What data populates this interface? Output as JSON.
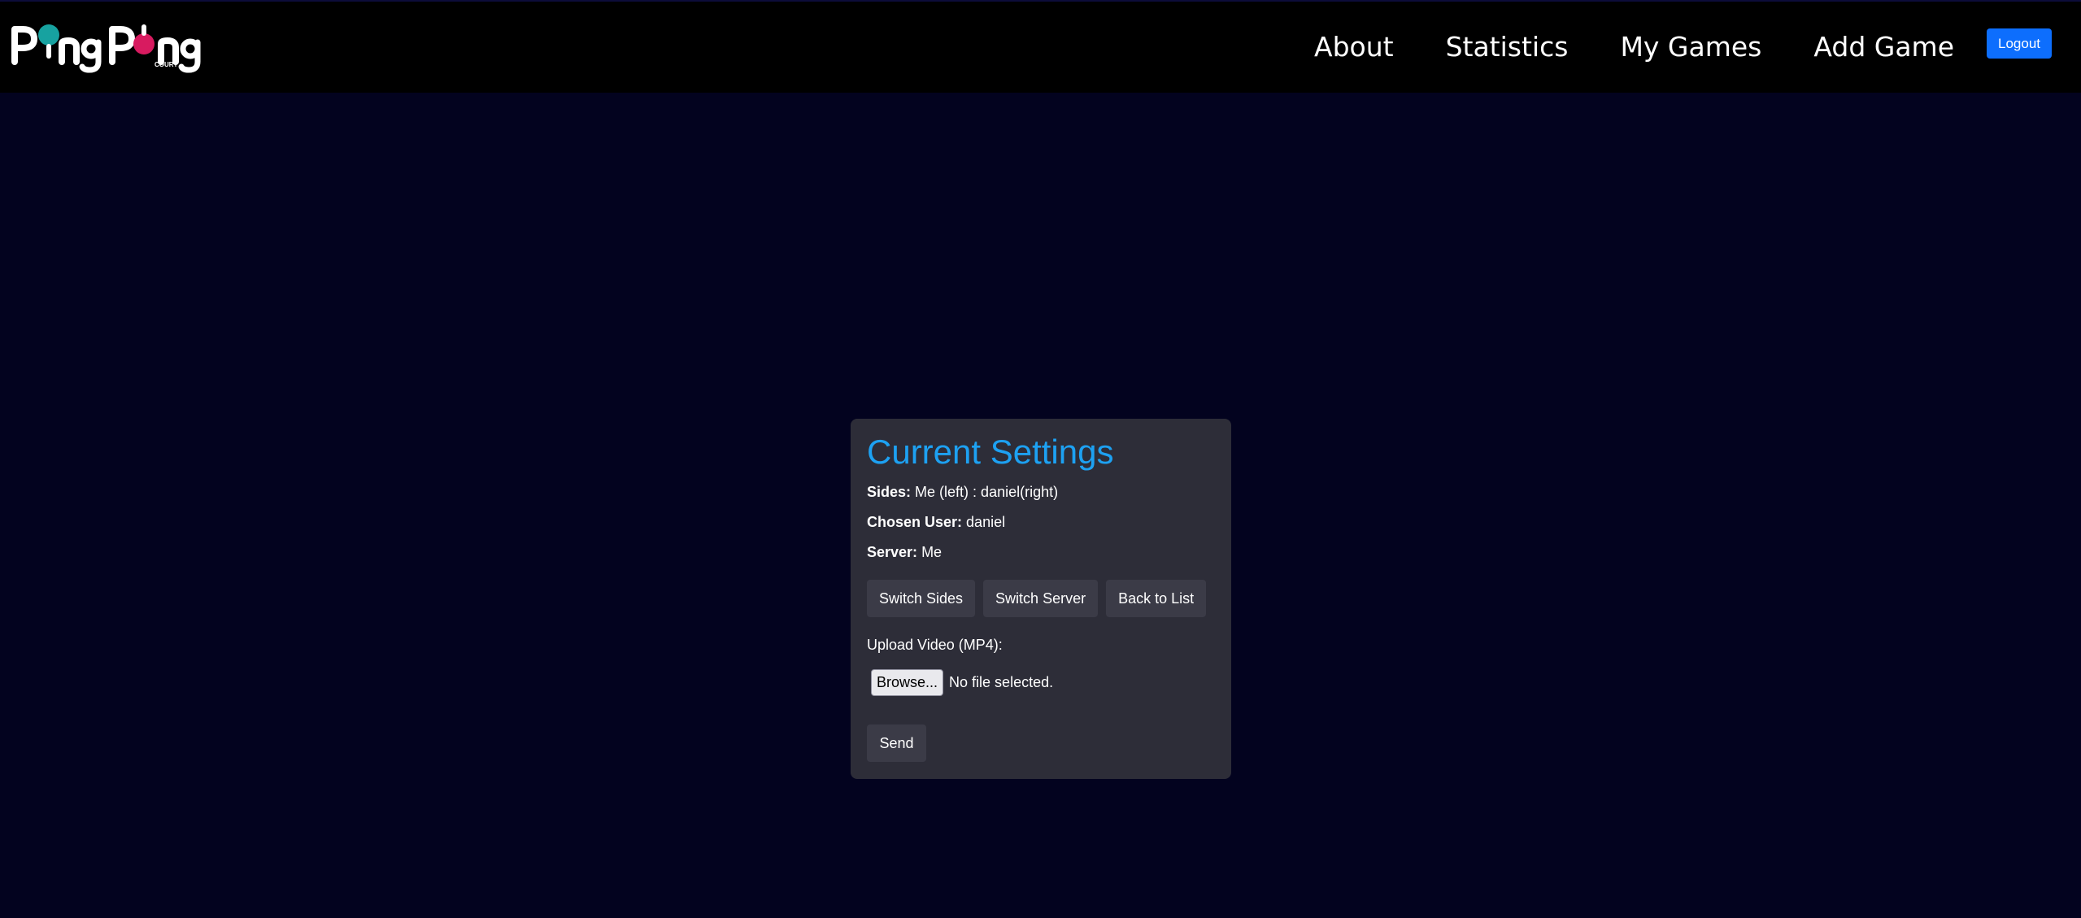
{
  "brand": {
    "logo_text": "PingPong",
    "logo_subtext": "COURT",
    "logo_colors": {
      "teal": "#17a2a0",
      "magenta": "#d81b60"
    }
  },
  "nav": {
    "links": [
      "About",
      "Statistics",
      "My Games",
      "Add Game"
    ],
    "logout_label": "Logout"
  },
  "settings": {
    "title": "Current Settings",
    "sides_label": "Sides:",
    "sides_value": "Me (left) : daniel(right)",
    "chosen_user_label": "Chosen User:",
    "chosen_user_value": "daniel",
    "server_label": "Server:",
    "server_value": "Me",
    "buttons": {
      "switch_sides": "Switch Sides",
      "switch_server": "Switch Server",
      "back_to_list": "Back to List"
    },
    "upload_label": "Upload Video (MP4):",
    "browse_label": "Browse...",
    "file_status": "No file selected.",
    "send_label": "Send"
  },
  "colors": {
    "page_bg": "#03031f",
    "nav_bg": "#000000",
    "card_bg": "#2d2d38",
    "title": "#1da1f2",
    "logout_bg": "#0d6efd"
  }
}
